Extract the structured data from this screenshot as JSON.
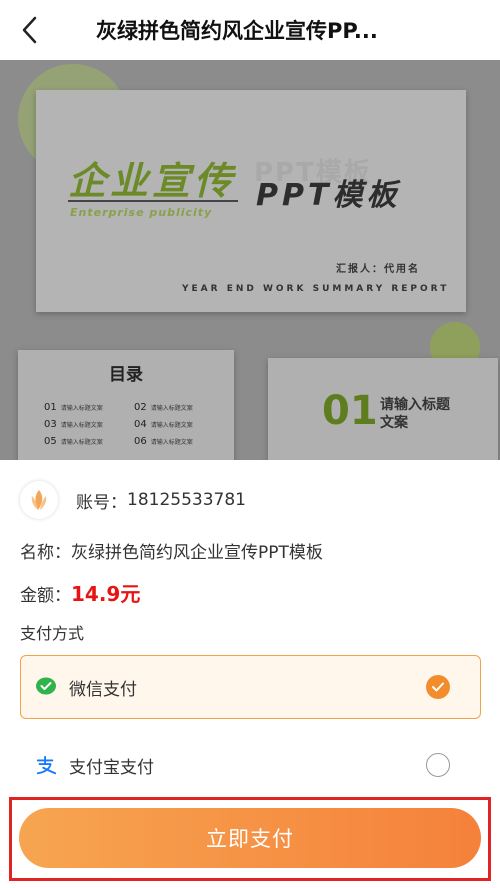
{
  "header": {
    "title": "灰绿拼色简约风企业宣传PP..."
  },
  "preview": {
    "main_slide": {
      "title": "企业宣传",
      "ghost_text": "PPT模板",
      "subtitle_cn": "PPT模板",
      "subtitle_en": "Enterprise publicity",
      "author": "汇报人：代用名",
      "report": "YEAR END WORK SUMMARY REPORT"
    },
    "toc_slide": {
      "title": "目录",
      "items": [
        {
          "num": "01",
          "text": "请输入标题文案"
        },
        {
          "num": "02",
          "text": "请输入标题文案"
        },
        {
          "num": "03",
          "text": "请输入标题文案"
        },
        {
          "num": "04",
          "text": "请输入标题文案"
        },
        {
          "num": "05",
          "text": "请输入标题文案"
        },
        {
          "num": "06",
          "text": "请输入标题文案"
        }
      ]
    },
    "section_slide": {
      "num": "01",
      "text": "请输入标题文案"
    }
  },
  "order": {
    "account_label": "账号：",
    "account_value": "18125533781",
    "name_label": "名称：",
    "name_value": "灰绿拼色简约风企业宣传PPT模板",
    "amount_label": "金额：",
    "amount_value": "14.9元",
    "pay_method_label": "支付方式"
  },
  "payment": {
    "options": [
      {
        "label": "微信支付",
        "selected": true,
        "icon": "wechat-pay-icon"
      },
      {
        "label": "支付宝支付",
        "selected": false,
        "icon": "alipay-icon"
      }
    ],
    "submit_label": "立即支付"
  },
  "colors": {
    "accent": "#f5813a",
    "price": "#e81414",
    "wechat_green": "#2fb34a",
    "alipay_blue": "#1677ff",
    "highlight_frame": "#e02424"
  }
}
